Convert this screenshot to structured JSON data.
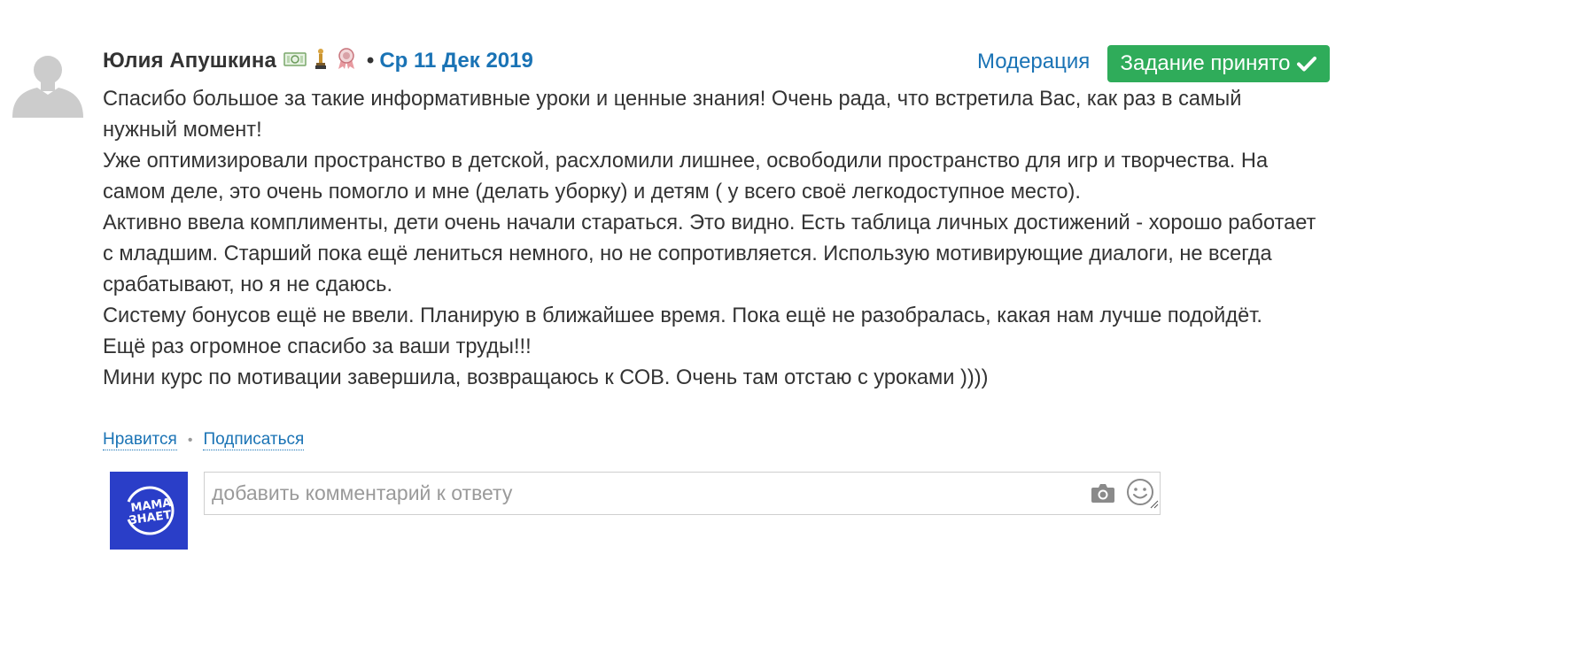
{
  "post": {
    "author": "Юлия Апушкина",
    "separator": "•",
    "date": "Ср 11 Дек 2019",
    "badges": [
      "money-badge-icon",
      "trophy-badge-icon",
      "medal-badge-icon"
    ],
    "lines": [
      "Спасибо большое за такие информативные уроки и ценные знания! Очень рада, что встретила Вас, как раз в самый",
      "нужный момент!",
      "Уже оптимизировали пространство в детской, расхломили лишнее, освободили пространство для игр и творчества. На",
      "самом деле, это очень помогло и мне (делать уборку) и детям ( у всего своё легкодоступное место).",
      "Активно ввела комплименты, дети очень начали стараться. Это видно. Есть таблица личных достижений - хорошо работает",
      "с младшим. Старший пока ещё лениться немного, но не сопротивляется. Использую мотивирующие диалоги, не всегда",
      "срабатывают, но я не сдаюсь.",
      "Систему бонусов ещё не ввели. Планирую в ближайшее время. Пока ещё не разобралась, какая нам лучше подойдёт.",
      "Ещё раз огромное спасибо за ваши труды!!!",
      "Мини курс по мотивации завершила, возвращаюсь к СОВ. Очень там отстаю с уроками ))))"
    ]
  },
  "header_actions": {
    "moderation": "Модерация",
    "accepted": "Задание принято"
  },
  "actions": {
    "like": "Нравится",
    "dot": "•",
    "subscribe": "Подписаться"
  },
  "comment": {
    "placeholder": "добавить комментарий к ответу",
    "logo_text_line1": "МАМА",
    "logo_text_line2": "ЗНАЕТ"
  },
  "colors": {
    "link": "#1a73b5",
    "accept_green": "#2fac5a",
    "logo_blue": "#2a3ec8"
  }
}
